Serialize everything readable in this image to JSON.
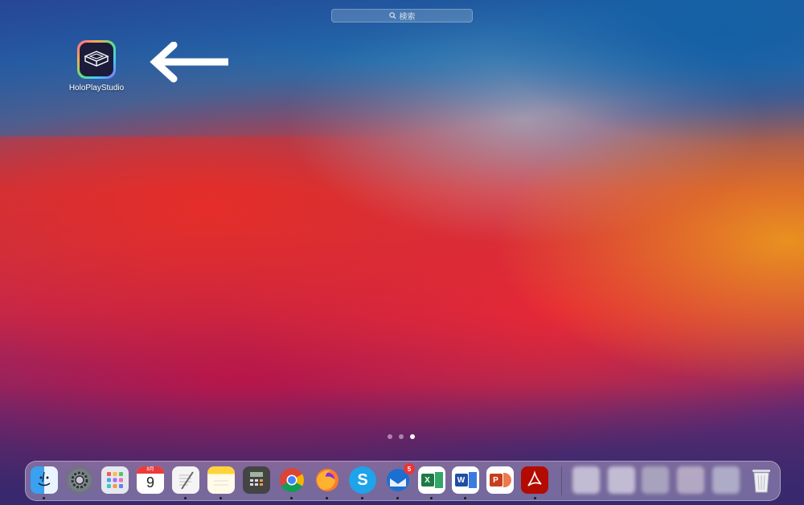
{
  "search": {
    "placeholder": "検索"
  },
  "desktop_app": {
    "label": "HoloPlayStudio",
    "icon": "holoplaystudio-icon"
  },
  "page_indicator": {
    "total": 3,
    "current": 3
  },
  "calendar": {
    "month": "8月",
    "day": "9"
  },
  "mail_badge": "5",
  "dock": {
    "apps": [
      {
        "name": "finder",
        "icon": "finder-icon"
      },
      {
        "name": "system-preferences",
        "icon": "gear-icon"
      },
      {
        "name": "launchpad",
        "icon": "launchpad-icon"
      },
      {
        "name": "calendar",
        "icon": "calendar-icon"
      },
      {
        "name": "textedit",
        "icon": "textedit-icon"
      },
      {
        "name": "notes",
        "icon": "notes-icon"
      },
      {
        "name": "calculator",
        "icon": "calculator-icon"
      },
      {
        "name": "chrome",
        "icon": "chrome-icon"
      },
      {
        "name": "firefox",
        "icon": "firefox-icon"
      },
      {
        "name": "skype",
        "icon": "skype-icon"
      },
      {
        "name": "thunderbird",
        "icon": "thunderbird-icon"
      },
      {
        "name": "excel",
        "icon": "excel-icon"
      },
      {
        "name": "word",
        "icon": "word-icon"
      },
      {
        "name": "powerpoint",
        "icon": "powerpoint-icon"
      },
      {
        "name": "acrobat",
        "icon": "acrobat-icon"
      },
      {
        "name": "trash",
        "icon": "trash-icon"
      }
    ]
  }
}
